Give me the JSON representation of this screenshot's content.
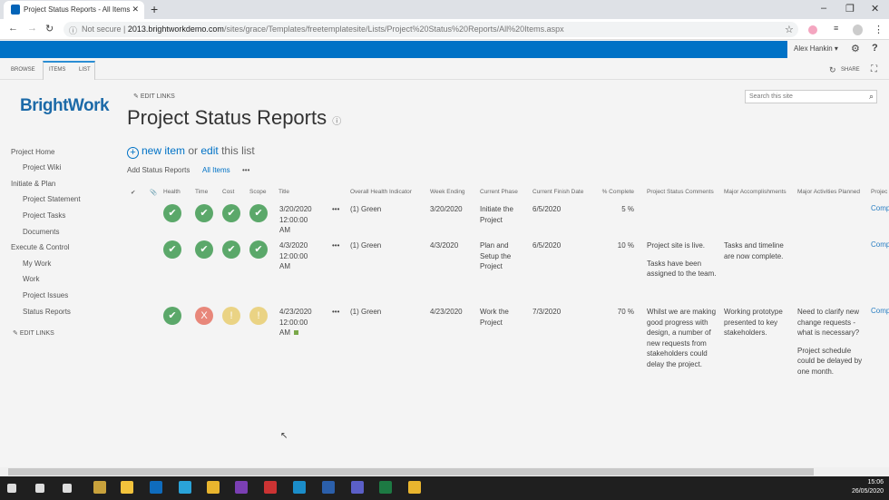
{
  "browser": {
    "tab_title": "Project Status Reports - All Items",
    "security": "Not secure",
    "url_domain": "2013.brightworkdemo.com",
    "url_path": "/sites/grace/Templates/freetemplatesite/Lists/Project%20Status%20Reports/All%20Items.aspx"
  },
  "suite": {
    "user": "Alex Hankin ▾"
  },
  "ribbon": {
    "tabs": [
      "BROWSE",
      "ITEMS",
      "LIST"
    ],
    "share": "SHARE"
  },
  "logo": "BrightWork",
  "edit_links": "EDIT LINKS",
  "page_title": "Project Status Reports",
  "search_placeholder": "Search this site",
  "nav": [
    {
      "label": "Project Home",
      "level": 0
    },
    {
      "label": "Project Wiki",
      "level": 1
    },
    {
      "label": "Initiate & Plan",
      "level": 0
    },
    {
      "label": "Project Statement",
      "level": 1
    },
    {
      "label": "Project Tasks",
      "level": 1
    },
    {
      "label": "Documents",
      "level": 1
    },
    {
      "label": "Execute & Control",
      "level": 0
    },
    {
      "label": "My Work",
      "level": 1
    },
    {
      "label": "Work",
      "level": 1
    },
    {
      "label": "Project Issues",
      "level": 1
    },
    {
      "label": "Status Reports",
      "level": 1
    }
  ],
  "new_item": {
    "new": "new item",
    "or": " or ",
    "edit": "edit",
    "rest": " this list"
  },
  "views": {
    "add": "Add Status Reports",
    "all": "All Items",
    "more": "•••"
  },
  "columns": [
    "Health",
    "Time",
    "Cost",
    "Scope",
    "Title",
    "Overall Health Indicator",
    "Week Ending",
    "Current Phase",
    "Current Finish Date",
    "% Complete",
    "Project Status Comments",
    "Major Accomplishments",
    "Major Activities Planned",
    "Projec"
  ],
  "rows": [
    {
      "status": [
        "ok",
        "ok",
        "ok",
        "ok"
      ],
      "title": [
        "3/20/2020",
        "12:00:00",
        "AM"
      ],
      "health": "(1) Green",
      "week": "3/20/2020",
      "phase": [
        "Initiate the",
        "Project"
      ],
      "finish": "6/5/2020",
      "pct": "5 %",
      "comments": [],
      "accomplishments": [],
      "planned": [],
      "link": "Comp"
    },
    {
      "status": [
        "ok",
        "ok",
        "ok",
        "ok"
      ],
      "title": [
        "4/3/2020",
        "12:00:00",
        "AM"
      ],
      "health": "(1) Green",
      "week": "4/3/2020",
      "phase": [
        "Plan and",
        "Setup the",
        "Project"
      ],
      "finish": "6/5/2020",
      "pct": "10 %",
      "comments": [
        "Project site is live.",
        "Tasks have been assigned to the team."
      ],
      "accomplishments": [
        "Tasks and timeline are now complete."
      ],
      "planned": [],
      "link": "Comp"
    },
    {
      "status": [
        "ok",
        "bad",
        "warn",
        "warn"
      ],
      "title": [
        "4/23/2020",
        "12:00:00",
        "AM"
      ],
      "health": "(1) Green",
      "week": "4/23/2020",
      "phase": [
        "Work the",
        "Project"
      ],
      "finish": "7/3/2020",
      "pct": "70 %",
      "comments": [
        "Whilst we are making good progress with design, a number of new requests from stakeholders could delay the project."
      ],
      "accomplishments": [
        "Working prototype presented to key stakeholders."
      ],
      "planned": [
        "Need to clarify new change requests - what is necessary?",
        "Project schedule could be delayed by one month."
      ],
      "link": "Comp"
    }
  ],
  "status_colors": {
    "ok": "#5ba86a",
    "bad": "#e8877a",
    "warn": "#ead384"
  },
  "clock": {
    "time": "15:06",
    "date": "26/05/2020"
  }
}
